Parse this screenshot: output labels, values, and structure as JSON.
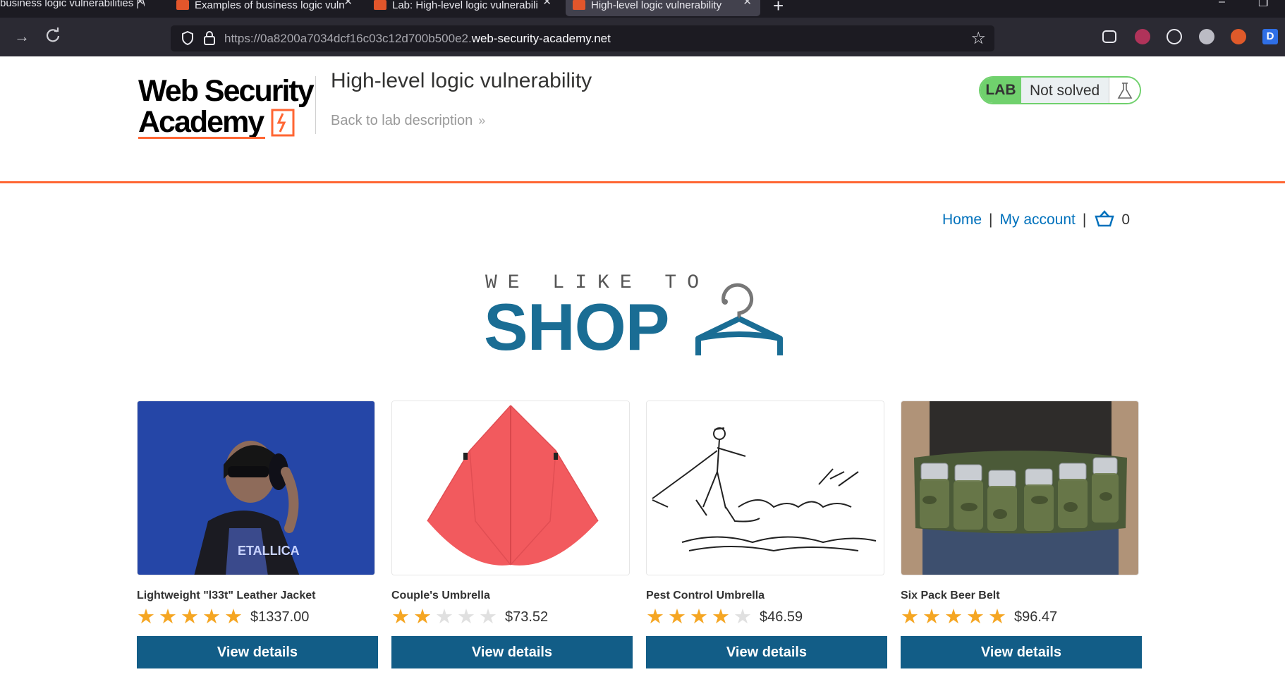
{
  "browser": {
    "tabs": [
      {
        "label": "business logic vulnerabilities | W",
        "active": false
      },
      {
        "label": "Examples of business logic vuln",
        "active": false
      },
      {
        "label": "Lab: High-level logic vulnerabili",
        "active": false
      },
      {
        "label": "High-level logic vulnerability",
        "active": true
      }
    ],
    "url_dim": "https://0a8200a7034dcf16c03c12d700b500e2.",
    "url_host": "web-security-academy.net",
    "icons": [
      "forward-icon",
      "reload-icon",
      "shield-icon",
      "lock-icon",
      "bookmark-star-icon"
    ]
  },
  "lab": {
    "logo_line1": "Web Security",
    "logo_line2": "Academy",
    "title": "High-level logic vulnerability",
    "back_link": "Back to lab description",
    "status_tag": "LAB",
    "status_text": "Not solved",
    "accent": "#ff6633",
    "status_color": "#70d16d"
  },
  "shop": {
    "nav": {
      "home": "Home",
      "sep1": "|",
      "account": "My account",
      "sep2": "|",
      "cart_count": "0"
    },
    "banner_top": "WE LIKE TO",
    "banner_main": "SHOP",
    "button_color": "#125d87",
    "products": [
      {
        "name": "Lightweight \"l33t\" Leather Jacket",
        "rating": 5,
        "price": "$1337.00",
        "button": "View details"
      },
      {
        "name": "Couple's Umbrella",
        "rating": 2,
        "price": "$73.52",
        "button": "View details"
      },
      {
        "name": "Pest Control Umbrella",
        "rating": 4,
        "price": "$46.59",
        "button": "View details"
      },
      {
        "name": "Six Pack Beer Belt",
        "rating": 5,
        "price": "$96.47",
        "button": "View details"
      }
    ]
  }
}
